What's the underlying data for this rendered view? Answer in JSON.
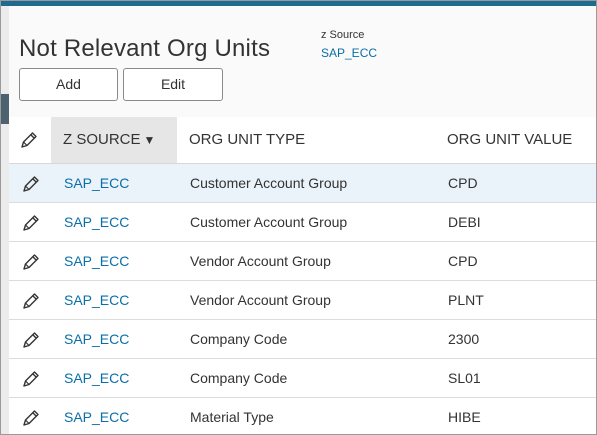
{
  "page": {
    "title": "Not Relevant Org Units",
    "z_source_label": "z Source",
    "z_source_value": "SAP_ECC"
  },
  "toolbar": {
    "add_label": "Add",
    "edit_label": "Edit"
  },
  "table": {
    "columns": {
      "source": "Z SOURCE",
      "type": "ORG UNIT TYPE",
      "value": "ORG UNIT VALUE"
    },
    "sort_indicator": "▼",
    "edit_icon": "pencil-icon",
    "rows": [
      {
        "source": "SAP_ECC",
        "type": "Customer Account Group",
        "value": "CPD"
      },
      {
        "source": "SAP_ECC",
        "type": "Customer Account Group",
        "value": "DEBI"
      },
      {
        "source": "SAP_ECC",
        "type": "Vendor Account Group",
        "value": "CPD"
      },
      {
        "source": "SAP_ECC",
        "type": "Vendor Account Group",
        "value": "PLNT"
      },
      {
        "source": "SAP_ECC",
        "type": "Company Code",
        "value": "2300"
      },
      {
        "source": "SAP_ECC",
        "type": "Company Code",
        "value": "SL01"
      },
      {
        "source": "SAP_ECC",
        "type": "Material Type",
        "value": "HIBE"
      }
    ]
  },
  "colors": {
    "accent": "#1e6b8f",
    "link": "#0a6ea8",
    "selected_row": "#eaf3fa"
  }
}
